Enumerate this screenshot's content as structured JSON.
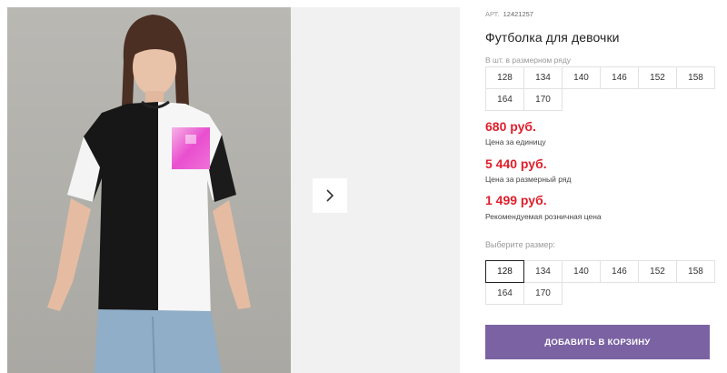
{
  "product": {
    "sku_label": "АРТ.",
    "sku_value": "12421257",
    "title": "Футболка для девочки"
  },
  "size_row": {
    "label": "В шт. в размерном ряду",
    "sizes": [
      "128",
      "134",
      "140",
      "146",
      "152",
      "158",
      "164",
      "170"
    ]
  },
  "prices": [
    {
      "value": "680 руб.",
      "note": "Цена за единицу"
    },
    {
      "value": "5 440 руб.",
      "note": "Цена за размерный ряд"
    },
    {
      "value": "1 499 руб.",
      "note": "Рекомендуемая розничная цена"
    }
  ],
  "size_select": {
    "label": "Выберите размер:",
    "sizes": [
      "128",
      "134",
      "140",
      "146",
      "152",
      "158",
      "164",
      "170"
    ],
    "selected": "128"
  },
  "actions": {
    "add_to_cart": "ДОБАВИТЬ В КОРЗИНУ"
  },
  "gallery": {
    "next_icon": "chevron-right-icon"
  },
  "colors": {
    "price": "#e01e2b",
    "button": "#7b62a3"
  }
}
